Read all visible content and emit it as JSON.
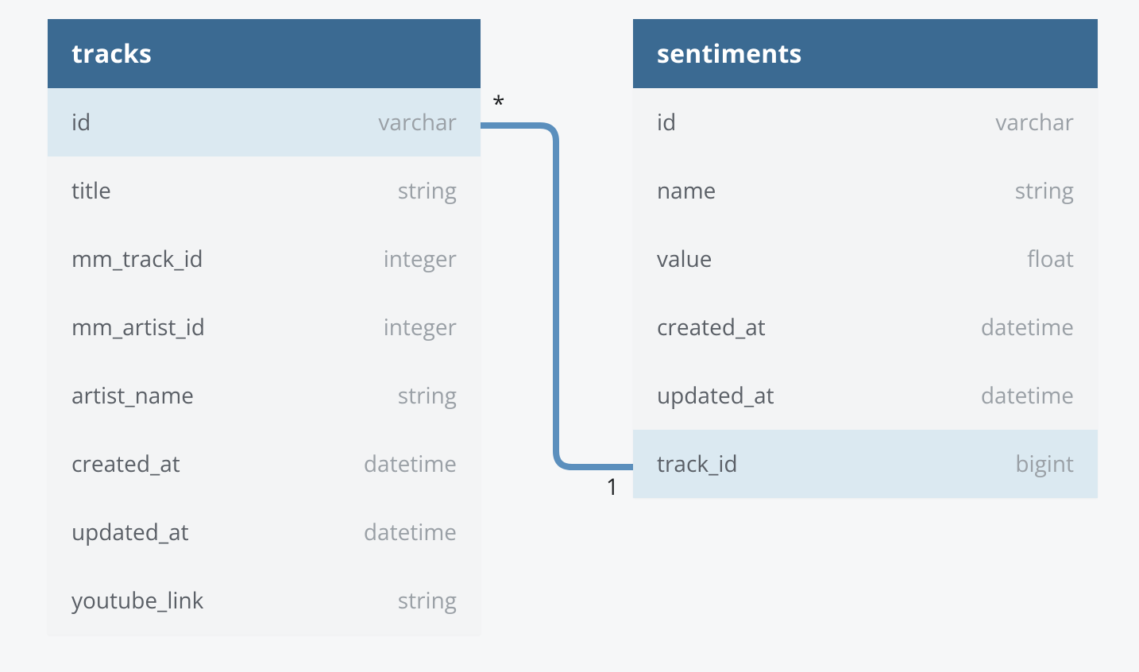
{
  "relationship": {
    "from": {
      "table": "tracks",
      "column": "id",
      "cardinality": "*"
    },
    "to": {
      "table": "sentiments",
      "column": "track_id",
      "cardinality": "1"
    }
  },
  "tables": {
    "tracks": {
      "title": "tracks",
      "columns": [
        {
          "name": "id",
          "type": "varchar",
          "highlight": true
        },
        {
          "name": "title",
          "type": "string",
          "highlight": false
        },
        {
          "name": "mm_track_id",
          "type": "integer",
          "highlight": false
        },
        {
          "name": "mm_artist_id",
          "type": "integer",
          "highlight": false
        },
        {
          "name": "artist_name",
          "type": "string",
          "highlight": false
        },
        {
          "name": "created_at",
          "type": "datetime",
          "highlight": false
        },
        {
          "name": "updated_at",
          "type": "datetime",
          "highlight": false
        },
        {
          "name": "youtube_link",
          "type": "string",
          "highlight": false
        }
      ]
    },
    "sentiments": {
      "title": "sentiments",
      "columns": [
        {
          "name": "id",
          "type": "varchar",
          "highlight": false
        },
        {
          "name": "name",
          "type": "string",
          "highlight": false
        },
        {
          "name": "value",
          "type": "float",
          "highlight": false
        },
        {
          "name": "created_at",
          "type": "datetime",
          "highlight": false
        },
        {
          "name": "updated_at",
          "type": "datetime",
          "highlight": false
        },
        {
          "name": "track_id",
          "type": "bigint",
          "highlight": true
        }
      ]
    }
  }
}
